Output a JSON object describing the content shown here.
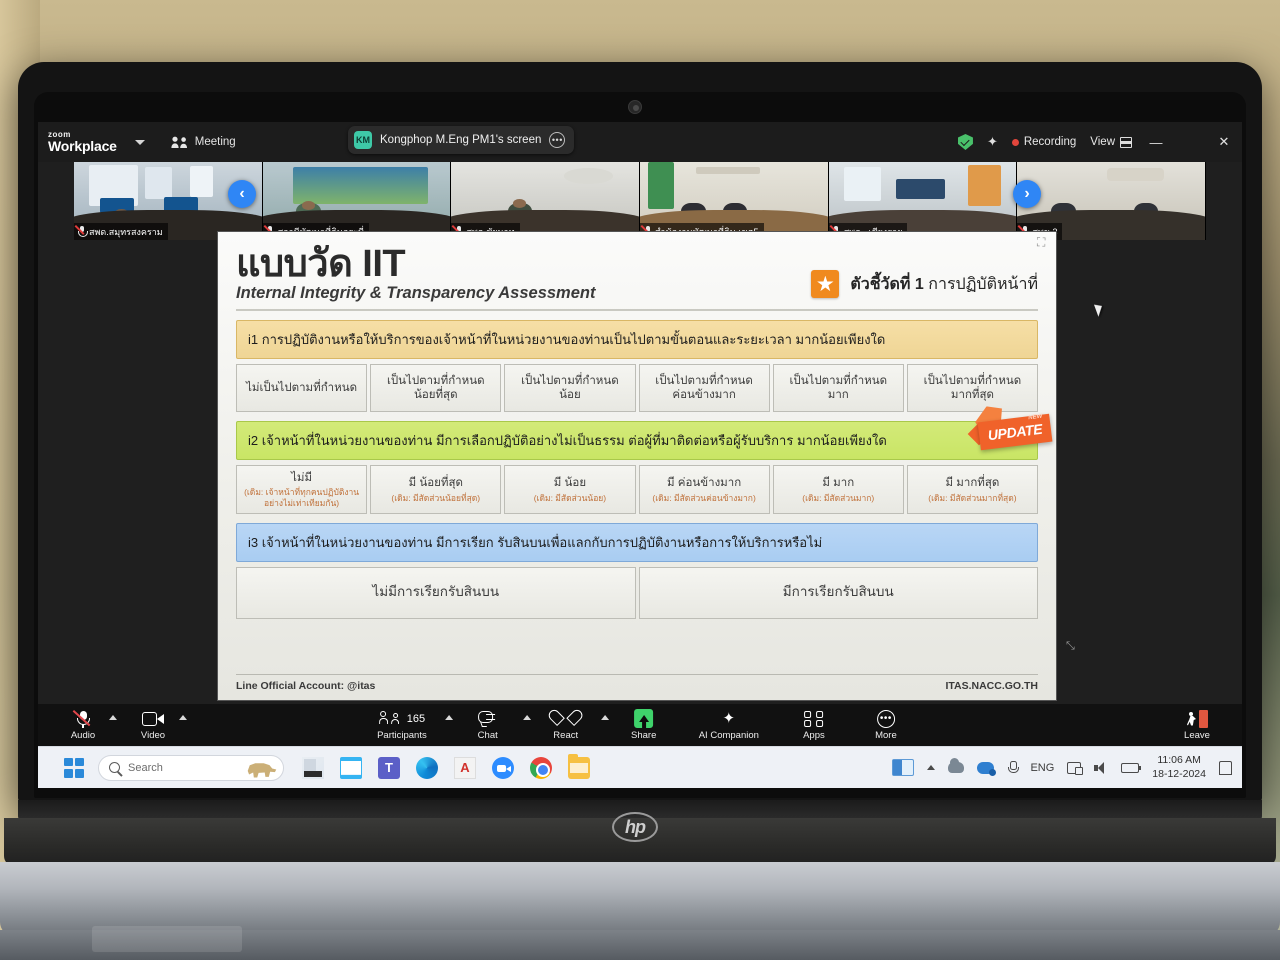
{
  "app": {
    "logo_line1": "zoom",
    "logo_line2": "Workplace",
    "meeting_label": "Meeting",
    "share_banner": "Kongphop M.Eng PM1's screen",
    "share_avatar_initials": "KM",
    "recording_label": "Recording",
    "view_label": "View",
    "accent_blue": "#2f86f5",
    "accent_green": "#3fd36b",
    "recording_red": "#e2463c"
  },
  "filmstrip": {
    "prev_arrow": "‹",
    "next_arrow": "›",
    "thumbs": [
      {
        "name": "สพด.สมุทรสงคราม"
      },
      {
        "name": "สถานีพัฒนาที่ดินกระบี่"
      },
      {
        "name": "สพด.ชัยนาท"
      },
      {
        "name": "สำนักงานพัฒนาที่ดิน เขต5"
      },
      {
        "name": "สพด._เชียงราย"
      },
      {
        "name": "สพข.3"
      }
    ]
  },
  "slide": {
    "title_th": "แบบวัด IIT",
    "title_en": "Internal Integrity & Transparency Assessment",
    "indicator_bold": "ตัวชี้วัดที่ 1",
    "indicator_rest": "การปฏิบัติหน้าที่",
    "star_icon": "star-icon",
    "update_badge": {
      "new": "NEW",
      "text": "UPDATE"
    },
    "questions": [
      {
        "id": "i1",
        "color": "orange",
        "text": "i1 การปฏิบัติงานหรือให้บริการของเจ้าหน้าที่ในหน่วยงานของท่านเป็นไปตามขั้นตอนและระยะเวลา มากน้อยเพียงใด",
        "options": [
          {
            "main": "ไม่เป็นไปตามที่กำหนด",
            "sub": ""
          },
          {
            "main": "เป็นไปตามที่กำหนด น้อยที่สุด",
            "sub": ""
          },
          {
            "main": "เป็นไปตามที่กำหนด น้อย",
            "sub": ""
          },
          {
            "main": "เป็นไปตามที่กำหนด ค่อนข้างมาก",
            "sub": ""
          },
          {
            "main": "เป็นไปตามที่กำหนด มาก",
            "sub": ""
          },
          {
            "main": "เป็นไปตามที่กำหนด มากที่สุด",
            "sub": ""
          }
        ]
      },
      {
        "id": "i2",
        "color": "green",
        "text": "i2 เจ้าหน้าที่ในหน่วยงานของท่าน มีการเลือกปฏิบัติอย่างไม่เป็นธรรม ต่อผู้ที่มาติดต่อหรือผู้รับบริการ มากน้อยเพียงใด",
        "options": [
          {
            "main": "ไม่มี",
            "sub": "(เดิม: เจ้าหน้าที่ทุกคนปฏิบัติงานอย่างไม่เท่าเทียมกัน)"
          },
          {
            "main": "มี น้อยที่สุด",
            "sub": "(เดิม: มีสัดส่วนน้อยที่สุด)"
          },
          {
            "main": "มี น้อย",
            "sub": "(เดิม: มีสัดส่วนน้อย)"
          },
          {
            "main": "มี ค่อนข้างมาก",
            "sub": "(เดิม: มีสัดส่วนค่อนข้างมาก)"
          },
          {
            "main": "มี มาก",
            "sub": "(เดิม: มีสัดส่วนมาก)"
          },
          {
            "main": "มี มากที่สุด",
            "sub": "(เดิม: มีสัดส่วนมากที่สุด)"
          }
        ]
      },
      {
        "id": "i3",
        "color": "blue",
        "text": "i3 เจ้าหน้าที่ในหน่วยงานของท่าน มีการเรียก รับสินบนเพื่อแลกกับการปฏิบัติงานหรือการให้บริการหรือไม่",
        "options": [
          {
            "main": "ไม่มีการเรียกรับสินบน",
            "sub": ""
          },
          {
            "main": "มีการเรียกรับสินบน",
            "sub": ""
          }
        ]
      }
    ],
    "footer_left": "Line Official Account: @itas",
    "footer_right": "ITAS.NACC.GO.TH"
  },
  "toolbar": {
    "audio": {
      "label": "Audio",
      "icon": "microphone-muted-icon"
    },
    "video": {
      "label": "Video",
      "icon": "camera-icon"
    },
    "participants": {
      "label": "Participants",
      "count": "165",
      "icon": "people-icon"
    },
    "chat": {
      "label": "Chat",
      "icon": "chat-bubble-icon"
    },
    "react": {
      "label": "React",
      "icon": "heart-icon"
    },
    "share": {
      "label": "Share",
      "icon": "share-screen-icon"
    },
    "ai": {
      "label": "AI Companion",
      "icon": "sparkle-icon"
    },
    "apps": {
      "label": "Apps",
      "icon": "apps-grid-icon"
    },
    "more": {
      "label": "More",
      "icon": "ellipsis-icon"
    },
    "leave": {
      "label": "Leave",
      "icon": "leave-door-icon"
    }
  },
  "taskbar": {
    "search_placeholder": "Search",
    "language": "ENG",
    "clock_time": "11:06 AM",
    "clock_date": "18-12-2024",
    "apps": [
      "file-explorer-icon",
      "mail-icon",
      "teams-icon",
      "edge-icon",
      "acrobat-icon",
      "zoom-icon",
      "chrome-icon",
      "folder-icon"
    ]
  },
  "device": {
    "brand": "hp"
  }
}
